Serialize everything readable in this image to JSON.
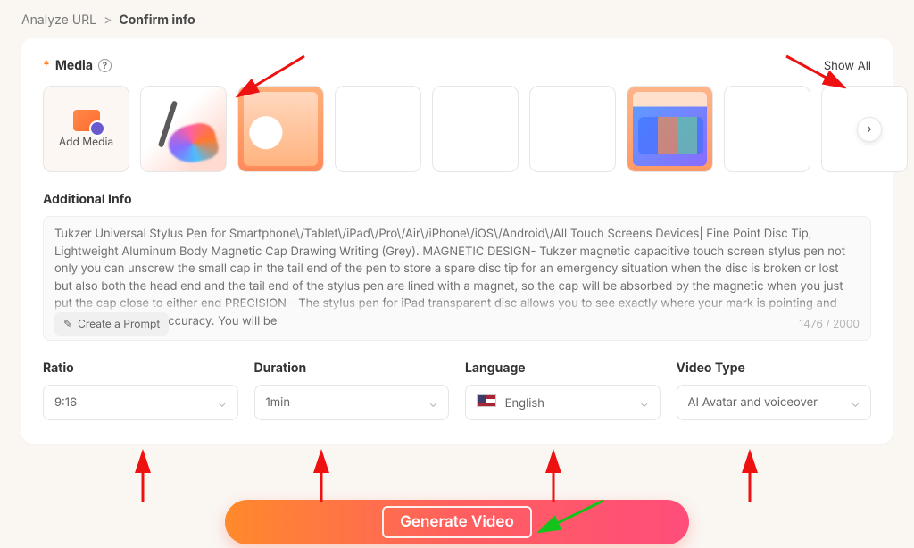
{
  "breadcrumb": {
    "step1": "Analyze URL",
    "sep": ">",
    "current": "Confirm info"
  },
  "media": {
    "ast": "*",
    "label": "Media",
    "show_all": "Show All",
    "add_media_label": "Add Media"
  },
  "additional_info": {
    "title": "Additional Info",
    "text": "Tukzer Universal Stylus Pen for Smartphone\\/Tablet\\/iPad\\/Pro\\/Air\\/iPhone\\/iOS\\/Android\\/All Touch Screens Devices| Fine Point Disc Tip, Lightweight Aluminum Body Magnetic Cap Drawing Writing (Grey). MAGNETIC DESIGN- Tukzer magnetic capacitive touch screen stylus pen not only you can unscrew the small cap in the tail end of the pen to store a spare disc tip for an emergency situation when the disc is broken or lost but also both the head end and the tail end of the stylus pen are lined with a magnet, so the cap will be absorbed by the magnetic when you just put the cap close to either end PRECISION - The stylus pen for iPad transparent disc allows you to see exactly where your mark is pointing and gives you supreme accuracy. You will be",
    "create_prompt": "Create a Prompt",
    "counter": "1476 / 2000"
  },
  "controls": {
    "ratio": {
      "label": "Ratio",
      "value": "9:16"
    },
    "duration": {
      "label": "Duration",
      "value": "1min"
    },
    "language": {
      "label": "Language",
      "value": "English"
    },
    "video_type": {
      "label": "Video Type",
      "value": "AI Avatar and voiceover"
    }
  },
  "generate_label": "Generate Video"
}
